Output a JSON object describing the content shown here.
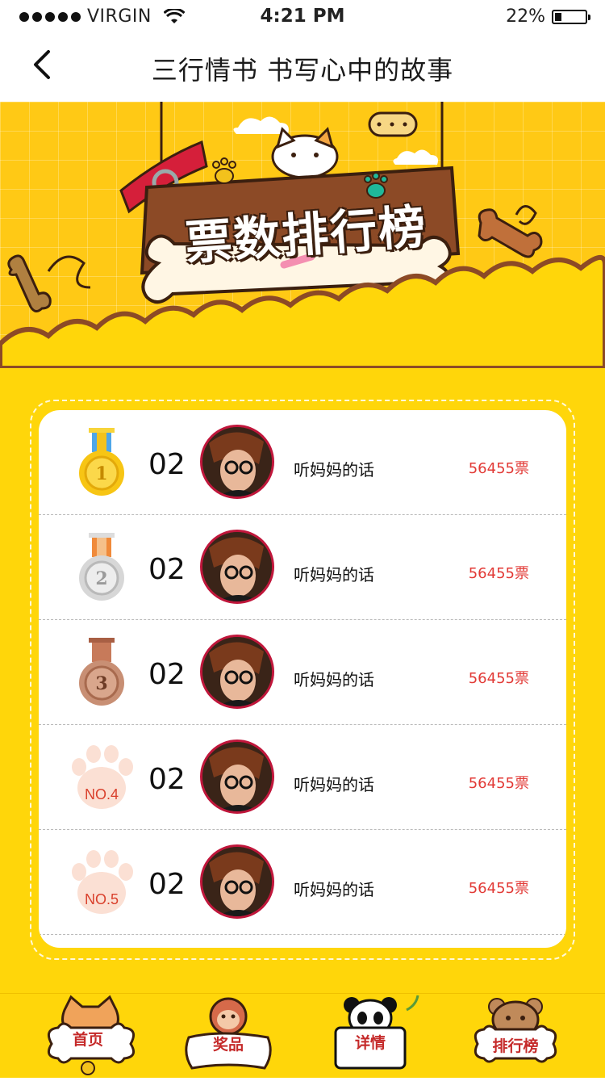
{
  "status_bar": {
    "carrier": "VIRGIN",
    "time": "4:21 PM",
    "battery": "22%",
    "battery_level": 0.22
  },
  "nav": {
    "title": "三行情书 书写心中的故事",
    "back_icon": "chevron-left-icon"
  },
  "banner": {
    "title": "票数排行榜"
  },
  "leaderboard": {
    "rows": [
      {
        "badge": "gold-medal-icon",
        "badge_text": "1",
        "number": "02",
        "name": "听妈妈的话",
        "votes": "56455票"
      },
      {
        "badge": "silver-medal-icon",
        "badge_text": "2",
        "number": "02",
        "name": "听妈妈的话",
        "votes": "56455票"
      },
      {
        "badge": "bronze-medal-icon",
        "badge_text": "3",
        "number": "02",
        "name": "听妈妈的话",
        "votes": "56455票"
      },
      {
        "badge": "paw-icon",
        "badge_text": "NO.4",
        "number": "02",
        "name": "听妈妈的话",
        "votes": "56455票"
      },
      {
        "badge": "paw-icon",
        "badge_text": "NO.5",
        "number": "02",
        "name": "听妈妈的话",
        "votes": "56455票"
      }
    ]
  },
  "tabs": [
    {
      "label": "首页",
      "icon": "cat-icon"
    },
    {
      "label": "奖品",
      "icon": "monkey-icon"
    },
    {
      "label": "详情",
      "icon": "panda-icon"
    },
    {
      "label": "排行榜",
      "icon": "bear-icon"
    }
  ],
  "colors": {
    "brand_yellow": "#ffd60a",
    "vote_red": "#e23a36",
    "avatar_border": "#c0163b"
  }
}
